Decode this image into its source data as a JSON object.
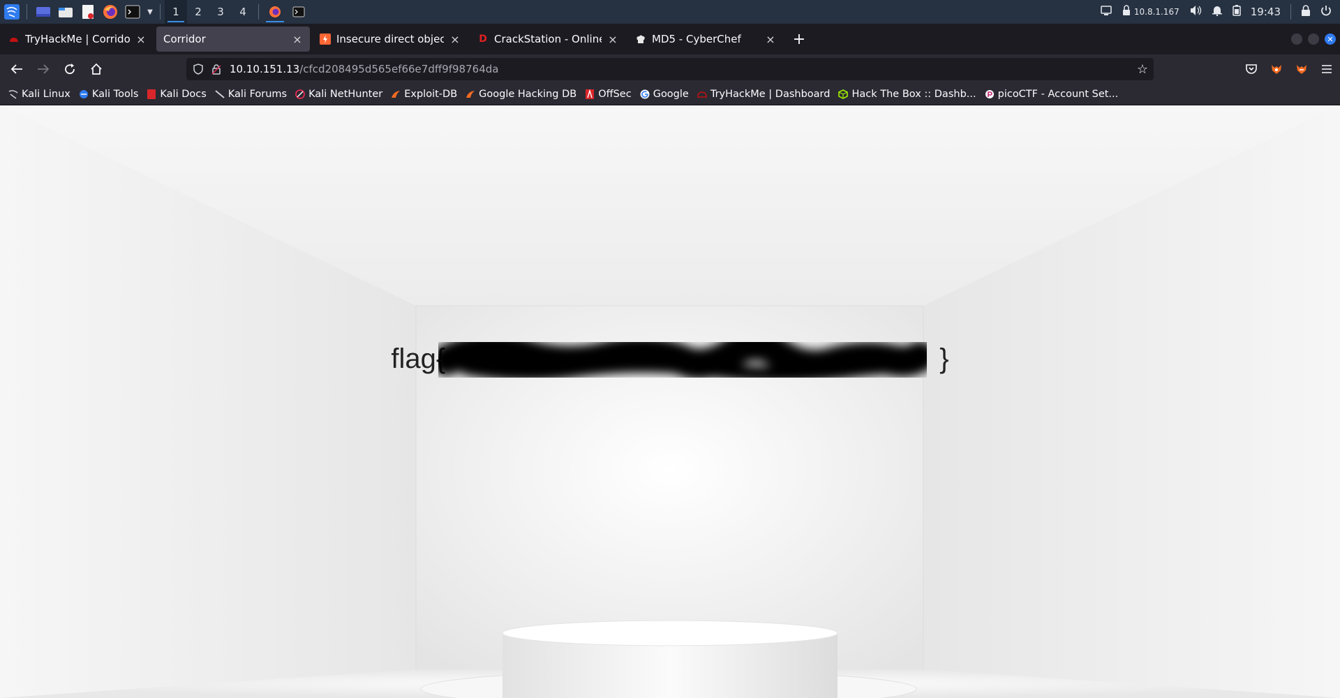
{
  "taskbar": {
    "workspaces": [
      "1",
      "2",
      "3",
      "4"
    ],
    "active_workspace": "1",
    "ip": "10.8.1.167",
    "clock": "19:43",
    "icons": [
      "kali-menu-icon",
      "desktop-icon",
      "file-manager-icon",
      "text-editor-icon",
      "firefox-icon",
      "terminal-icon",
      "chevron-down-icon",
      "display-icon",
      "vpn-icon",
      "volume-icon",
      "bell-icon",
      "battery-icon",
      "lock-icon",
      "power-icon"
    ]
  },
  "tabs": [
    {
      "title": "TryHackMe | Corridor",
      "favicon": "thm-icon",
      "active": false
    },
    {
      "title": "Corridor",
      "favicon": "",
      "active": true
    },
    {
      "title": "Insecure direct object refe",
      "favicon": "portswigger-icon",
      "active": false
    },
    {
      "title": "CrackStation - Online Pass",
      "favicon": "crackstation-icon",
      "active": false
    },
    {
      "title": "MD5 - CyberChef",
      "favicon": "cyberchef-icon",
      "active": false
    }
  ],
  "url": {
    "host": "10.10.151.13",
    "path": "/cfcd208495d565ef66e7dff9f98764da"
  },
  "bookmarks": [
    {
      "label": "Kali Linux",
      "icon": "kali-icon"
    },
    {
      "label": "Kali Tools",
      "icon": "kali-tools-icon"
    },
    {
      "label": "Kali Docs",
      "icon": "kali-docs-icon"
    },
    {
      "label": "Kali Forums",
      "icon": "kali-forums-icon"
    },
    {
      "label": "Kali NetHunter",
      "icon": "nethunter-icon"
    },
    {
      "label": "Exploit-DB",
      "icon": "exploitdb-icon"
    },
    {
      "label": "Google Hacking DB",
      "icon": "ghdb-icon"
    },
    {
      "label": "OffSec",
      "icon": "offsec-icon"
    },
    {
      "label": "Google",
      "icon": "google-icon"
    },
    {
      "label": "TryHackMe | Dashboard",
      "icon": "thm-icon"
    },
    {
      "label": "Hack The Box :: Dashb...",
      "icon": "htb-icon"
    },
    {
      "label": "picoCTF - Account Set...",
      "icon": "picoctf-icon"
    }
  ],
  "page": {
    "flag_prefix": "flag{",
    "flag_suffix": "}"
  }
}
